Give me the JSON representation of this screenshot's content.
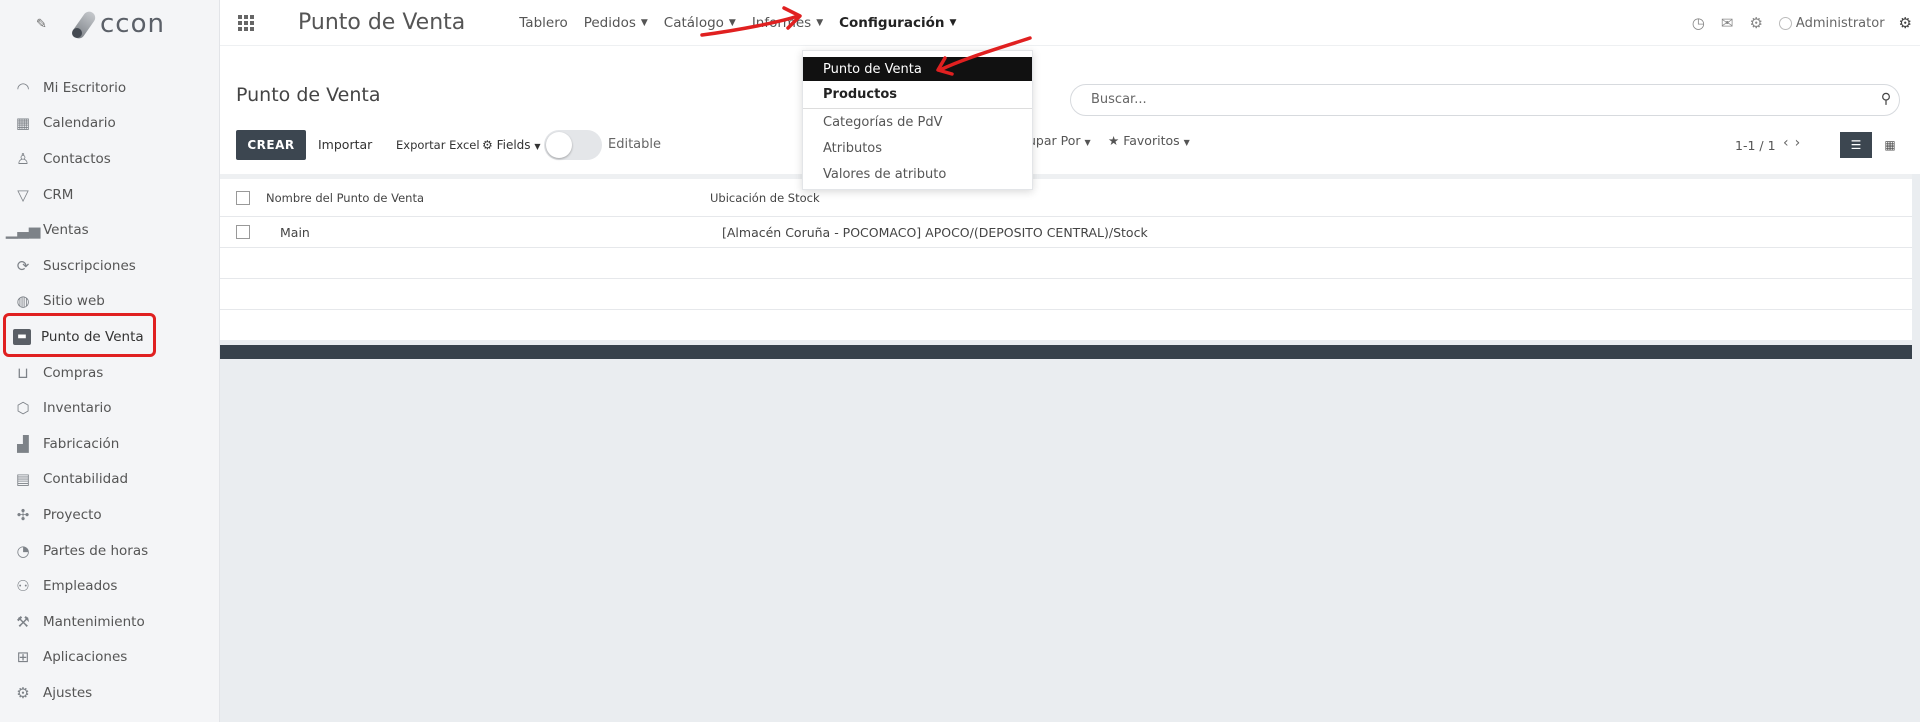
{
  "sidebar": {
    "logo_text": "ccon",
    "items": [
      {
        "label": "Mi Escritorio",
        "icon": "dashboard-icon"
      },
      {
        "label": "Calendario",
        "icon": "calendar-icon"
      },
      {
        "label": "Contactos",
        "icon": "person-icon"
      },
      {
        "label": "CRM",
        "icon": "funnel-icon"
      },
      {
        "label": "Ventas",
        "icon": "bar-chart-icon"
      },
      {
        "label": "Suscripciones",
        "icon": "refresh-icon"
      },
      {
        "label": "Sitio web",
        "icon": "globe-icon"
      },
      {
        "label": "Punto de Venta",
        "icon": "pos-icon"
      },
      {
        "label": "Compras",
        "icon": "basket-icon"
      },
      {
        "label": "Inventario",
        "icon": "box-icon"
      },
      {
        "label": "Fabricación",
        "icon": "factory-icon"
      },
      {
        "label": "Contabilidad",
        "icon": "calculator-icon"
      },
      {
        "label": "Proyecto",
        "icon": "puzzle-icon"
      },
      {
        "label": "Partes de horas",
        "icon": "stopwatch-icon"
      },
      {
        "label": "Empleados",
        "icon": "people-icon"
      },
      {
        "label": "Mantenimiento",
        "icon": "wrench-icon"
      },
      {
        "label": "Aplicaciones",
        "icon": "apps-grid-icon"
      },
      {
        "label": "Ajustes",
        "icon": "gear-icon"
      }
    ]
  },
  "topbar": {
    "app_title": "Punto de Venta",
    "menu": [
      {
        "label": "Tablero",
        "caret": false
      },
      {
        "label": "Pedidos",
        "caret": true
      },
      {
        "label": "Catálogo",
        "caret": true
      },
      {
        "label": "Informes",
        "caret": true
      },
      {
        "label": "Configuración",
        "caret": true
      }
    ],
    "user": "Administrator"
  },
  "dropdown": {
    "items": [
      {
        "label": "Punto de Venta"
      },
      {
        "label": "Productos"
      },
      {
        "label": "Categorías de PdV"
      },
      {
        "label": "Atributos"
      },
      {
        "label": "Valores de atributo"
      }
    ]
  },
  "control": {
    "breadcrumb": "Punto de Venta",
    "create": "CREAR",
    "import": "Importar",
    "export": "Exportar Excel",
    "fields": "Fields",
    "editable": "Editable",
    "search_placeholder": "Buscar...",
    "groupby": "upar Por",
    "favorites": "Favoritos",
    "pager": "1-1 / 1"
  },
  "table": {
    "columns": [
      "Nombre del Punto de Venta",
      "Ubicación de Stock"
    ],
    "rows": [
      {
        "name": "Main",
        "location": "[Almacén Coruña - POCOMACO] APOCO/(DEPOSITO CENTRAL)/Stock"
      }
    ]
  },
  "colors": {
    "accent_dark": "#3c4650",
    "annotation_red": "#e02020"
  }
}
